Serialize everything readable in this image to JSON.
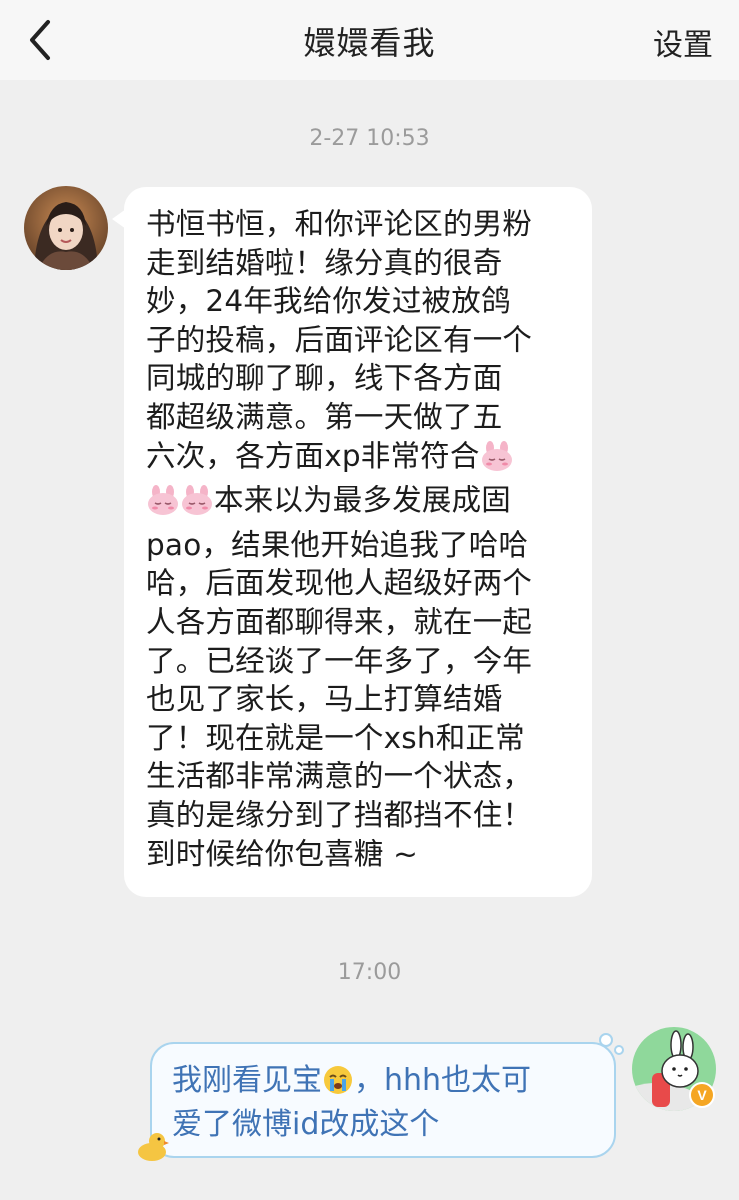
{
  "header": {
    "back_icon": "chevron-left-icon",
    "title": "嬛嬛看我",
    "settings_label": "设置"
  },
  "messages": [
    {
      "timestamp": "2-27 10:53",
      "side": "left",
      "avatar": "user-photo-avatar",
      "lines": [
        "书恒书恒，和你评论区的男粉",
        "走到结婚啦！缘分真的很奇",
        "妙，24年我给你发过被放鸽",
        "子的投稿，后面评论区有一个",
        "同城的聊了聊，线下各方面",
        "都超级满意。第一天做了五",
        "六次，各方面xp非常符合",
        "本来以为最多发展成固",
        "pao，结果他开始追我了哈哈",
        "哈，后面发现他人超级好两个",
        "人各方面都聊得来，就在一起",
        "了。已经谈了一年多了，今年",
        "也见了家长，马上打算结婚",
        "了！现在就是一个xsh和正常",
        "生活都非常满意的一个状态，",
        "真的是缘分到了挡都挡不住！",
        "到时候给你包喜糖 ~"
      ],
      "emoji": "pink-bunny-emoji"
    },
    {
      "timestamp": "17:00",
      "side": "right",
      "avatar": "cartoon-bunny-avatar",
      "badge": "V",
      "line1_part1": "我刚看见宝",
      "line1_part2": "，hhh也太可",
      "line2": "爱了微博id改成这个",
      "emoji": "crying-face-emoji",
      "decoration": "duck-icon"
    }
  ]
}
